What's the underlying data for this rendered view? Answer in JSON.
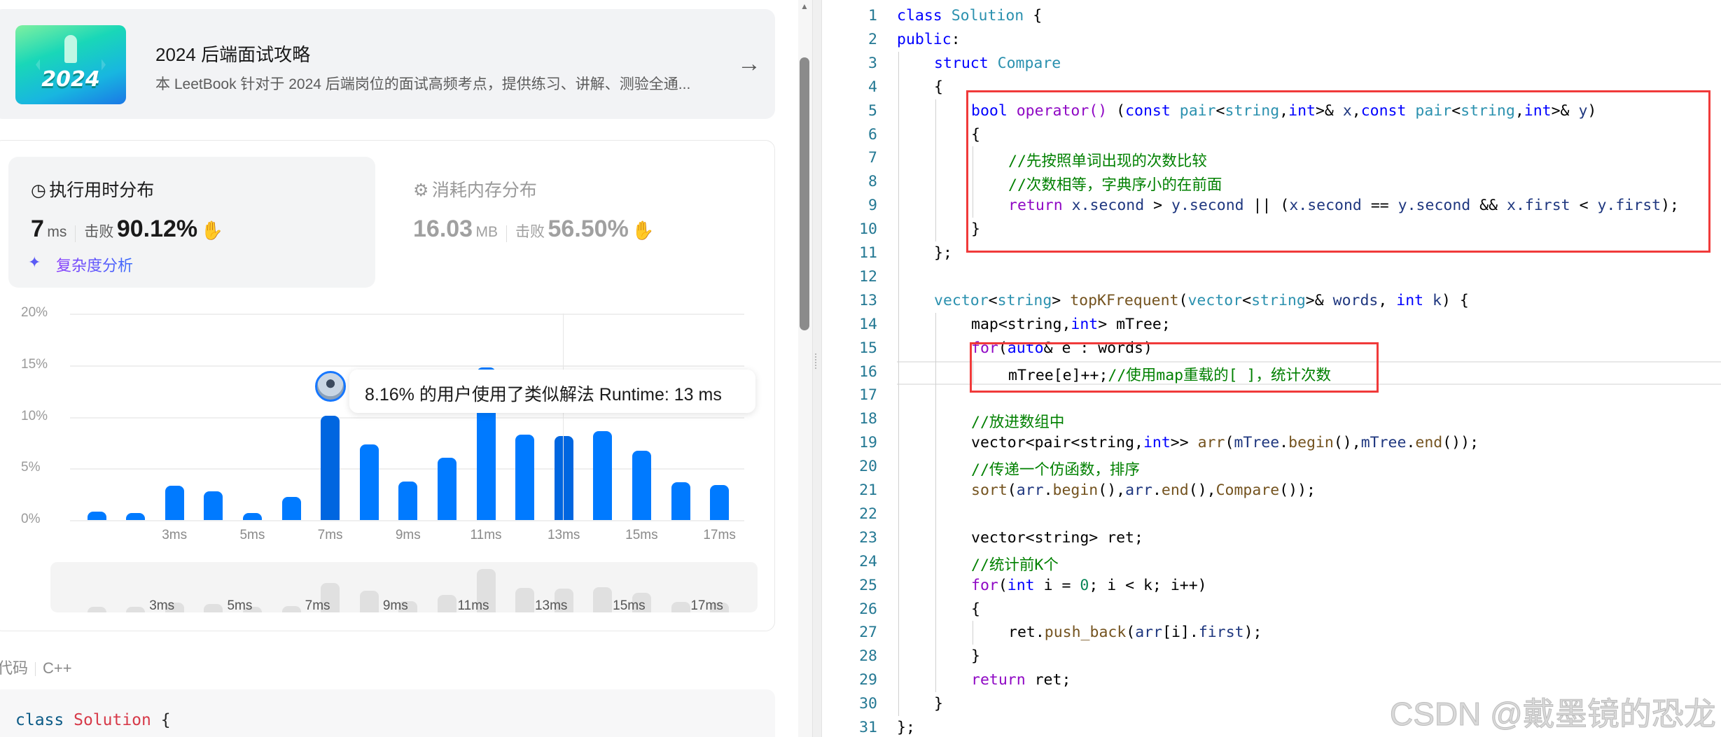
{
  "book": {
    "cover_text": "2024",
    "title": "2024 后端面试攻略",
    "description": "本 LeetBook 针对于 2024 后端岗位的面试高频考点，提供练习、讲解、测验全通...",
    "arrow_icon": "arrow-right-icon"
  },
  "runtime": {
    "title": "执行用时分布",
    "value": "7",
    "unit": "ms",
    "beat_label": "击败",
    "beat_value": "90.12%",
    "complexity_label": "复杂度分析"
  },
  "memory": {
    "title": "消耗内存分布",
    "value": "16.03",
    "unit": "MB",
    "beat_label": "击败",
    "beat_value": "56.50%"
  },
  "tooltip": {
    "text": "8.16% 的用户使用了类似解法 Runtime: 13 ms"
  },
  "colors": {
    "bar": "#007aff",
    "bar_highlight": "#0066e0",
    "mini_bar": "#e0e0e0",
    "highlight_box": "#f03a3a"
  },
  "chart_data": {
    "type": "bar",
    "x": [
      1,
      2,
      3,
      4,
      5,
      6,
      7,
      8,
      9,
      10,
      11,
      12,
      13,
      14,
      15,
      16,
      17
    ],
    "values": [
      0.8,
      0.7,
      3.35,
      2.75,
      0.7,
      2.25,
      10.1,
      7.3,
      3.75,
      6.05,
      14.8,
      8.25,
      8.16,
      8.6,
      6.7,
      3.65,
      3.4
    ],
    "highlighted": [
      7,
      13
    ],
    "ylim": [
      0,
      20
    ],
    "yticks": [
      "0%",
      "5%",
      "10%",
      "15%",
      "20%"
    ],
    "xticks": [
      "3ms",
      "5ms",
      "7ms",
      "9ms",
      "11ms",
      "13ms",
      "15ms",
      "17ms"
    ],
    "grid": true
  },
  "code_section": {
    "label": "代码",
    "language": "C++",
    "lines": [
      [
        {
          "t": "class ",
          "s": "k"
        },
        {
          "t": "Solution",
          "s": "c2"
        },
        {
          "t": " {",
          "s": "p"
        }
      ],
      [
        {
          "t": "public:",
          "s": "k"
        }
      ]
    ]
  },
  "code": {
    "lines": [
      {
        "i": 0,
        "tk": [
          {
            "t": "class",
            "s": "k"
          },
          {
            "t": " ",
            "s": "p"
          },
          {
            "t": "Solution",
            "s": "t"
          },
          {
            "t": " {",
            "s": "p"
          }
        ]
      },
      {
        "i": 0,
        "tk": [
          {
            "t": "public",
            "s": "k"
          },
          {
            "t": ":",
            "s": "p"
          }
        ]
      },
      {
        "i": 1,
        "tk": [
          {
            "t": "struct",
            "s": "k"
          },
          {
            "t": " ",
            "s": "p"
          },
          {
            "t": "Compare",
            "s": "t"
          }
        ]
      },
      {
        "i": 1,
        "tk": [
          {
            "t": "{",
            "s": "p"
          }
        ]
      },
      {
        "i": 2,
        "tk": [
          {
            "t": "bool",
            "s": "k"
          },
          {
            "t": " ",
            "s": "p"
          },
          {
            "t": "operator()",
            "s": "c"
          },
          {
            "t": " (",
            "s": "p"
          },
          {
            "t": "const",
            "s": "k"
          },
          {
            "t": " ",
            "s": "p"
          },
          {
            "t": "pair",
            "s": "t"
          },
          {
            "t": "<",
            "s": "p"
          },
          {
            "t": "string",
            "s": "t"
          },
          {
            "t": ",",
            "s": "p"
          },
          {
            "t": "int",
            "s": "k"
          },
          {
            "t": ">& ",
            "s": "p"
          },
          {
            "t": "x",
            "s": "v"
          },
          {
            "t": ",",
            "s": "p"
          },
          {
            "t": "const",
            "s": "k"
          },
          {
            "t": " ",
            "s": "p"
          },
          {
            "t": "pair",
            "s": "t"
          },
          {
            "t": "<",
            "s": "p"
          },
          {
            "t": "string",
            "s": "t"
          },
          {
            "t": ",",
            "s": "p"
          },
          {
            "t": "int",
            "s": "k"
          },
          {
            "t": ">& ",
            "s": "p"
          },
          {
            "t": "y",
            "s": "v"
          },
          {
            "t": ")",
            "s": "p"
          }
        ]
      },
      {
        "i": 2,
        "tk": [
          {
            "t": "{",
            "s": "p"
          }
        ]
      },
      {
        "i": 3,
        "tk": [
          {
            "t": "//先按照单词出现的次数比较",
            "s": "m"
          }
        ]
      },
      {
        "i": 3,
        "tk": [
          {
            "t": "//次数相等，字典序小的在前面",
            "s": "m"
          }
        ]
      },
      {
        "i": 3,
        "tk": [
          {
            "t": "return",
            "s": "c"
          },
          {
            "t": " ",
            "s": "p"
          },
          {
            "t": "x.second",
            "s": "v"
          },
          {
            "t": " > ",
            "s": "p"
          },
          {
            "t": "y.second",
            "s": "v"
          },
          {
            "t": " || (",
            "s": "p"
          },
          {
            "t": "x.second",
            "s": "v"
          },
          {
            "t": " == ",
            "s": "p"
          },
          {
            "t": "y.second",
            "s": "v"
          },
          {
            "t": " && ",
            "s": "p"
          },
          {
            "t": "x.first",
            "s": "v"
          },
          {
            "t": " < ",
            "s": "p"
          },
          {
            "t": "y.first",
            "s": "v"
          },
          {
            "t": ");",
            "s": "p"
          }
        ]
      },
      {
        "i": 2,
        "tk": [
          {
            "t": "}",
            "s": "p"
          }
        ]
      },
      {
        "i": 1,
        "tk": [
          {
            "t": "};",
            "s": "p"
          }
        ]
      },
      {
        "i": 0,
        "tk": []
      },
      {
        "i": 1,
        "tk": [
          {
            "t": "vector",
            "s": "t"
          },
          {
            "t": "<",
            "s": "p"
          },
          {
            "t": "string",
            "s": "t"
          },
          {
            "t": "> ",
            "s": "p"
          },
          {
            "t": "topKFrequent",
            "s": "f"
          },
          {
            "t": "(",
            "s": "p"
          },
          {
            "t": "vector",
            "s": "t"
          },
          {
            "t": "<",
            "s": "p"
          },
          {
            "t": "string",
            "s": "t"
          },
          {
            "t": ">& ",
            "s": "p"
          },
          {
            "t": "words",
            "s": "v"
          },
          {
            "t": ", ",
            "s": "p"
          },
          {
            "t": "int",
            "s": "k"
          },
          {
            "t": " ",
            "s": "p"
          },
          {
            "t": "k",
            "s": "v"
          },
          {
            "t": ") {",
            "s": "p"
          }
        ]
      },
      {
        "i": 2,
        "tk": [
          {
            "t": "map<string,",
            "s": "p"
          },
          {
            "t": "int",
            "s": "k"
          },
          {
            "t": "> mTree;",
            "s": "p"
          }
        ]
      },
      {
        "i": 2,
        "tk": [
          {
            "t": "for",
            "s": "c"
          },
          {
            "t": "(",
            "s": "p"
          },
          {
            "t": "auto",
            "s": "k"
          },
          {
            "t": "& e : words)",
            "s": "p"
          }
        ]
      },
      {
        "i": 3,
        "tk": [
          {
            "t": "mTree[e]++;",
            "s": "p"
          },
          {
            "t": "//使用map重载的[ ]，统计次数",
            "s": "m"
          }
        ]
      },
      {
        "i": 0,
        "tk": []
      },
      {
        "i": 2,
        "tk": [
          {
            "t": "//放进数组中",
            "s": "m"
          }
        ]
      },
      {
        "i": 2,
        "tk": [
          {
            "t": "vector<pair<string,",
            "s": "p"
          },
          {
            "t": "int",
            "s": "k"
          },
          {
            "t": ">> ",
            "s": "p"
          },
          {
            "t": "arr",
            "s": "f"
          },
          {
            "t": "(",
            "s": "p"
          },
          {
            "t": "mTree",
            "s": "v"
          },
          {
            "t": ".",
            "s": "p"
          },
          {
            "t": "begin",
            "s": "f"
          },
          {
            "t": "(),",
            "s": "p"
          },
          {
            "t": "mTree",
            "s": "v"
          },
          {
            "t": ".",
            "s": "p"
          },
          {
            "t": "end",
            "s": "f"
          },
          {
            "t": "());",
            "s": "p"
          }
        ]
      },
      {
        "i": 2,
        "tk": [
          {
            "t": "//传递一个仿函数，排序",
            "s": "m"
          }
        ]
      },
      {
        "i": 2,
        "tk": [
          {
            "t": "sort",
            "s": "f"
          },
          {
            "t": "(",
            "s": "p"
          },
          {
            "t": "arr",
            "s": "v"
          },
          {
            "t": ".",
            "s": "p"
          },
          {
            "t": "begin",
            "s": "f"
          },
          {
            "t": "(),",
            "s": "p"
          },
          {
            "t": "arr",
            "s": "v"
          },
          {
            "t": ".",
            "s": "p"
          },
          {
            "t": "end",
            "s": "f"
          },
          {
            "t": "(),",
            "s": "p"
          },
          {
            "t": "Compare",
            "s": "f"
          },
          {
            "t": "());",
            "s": "p"
          }
        ]
      },
      {
        "i": 0,
        "tk": []
      },
      {
        "i": 2,
        "tk": [
          {
            "t": "vector<string> ret;",
            "s": "p"
          }
        ]
      },
      {
        "i": 2,
        "tk": [
          {
            "t": "//统计前K个",
            "s": "m"
          }
        ]
      },
      {
        "i": 2,
        "tk": [
          {
            "t": "for",
            "s": "c"
          },
          {
            "t": "(",
            "s": "p"
          },
          {
            "t": "int",
            "s": "k"
          },
          {
            "t": " i = ",
            "s": "p"
          },
          {
            "t": "0",
            "s": "n"
          },
          {
            "t": "; i < k; i++)",
            "s": "p"
          }
        ]
      },
      {
        "i": 2,
        "tk": [
          {
            "t": "{",
            "s": "p"
          }
        ]
      },
      {
        "i": 3,
        "tk": [
          {
            "t": "ret.",
            "s": "p"
          },
          {
            "t": "push_back",
            "s": "f"
          },
          {
            "t": "(",
            "s": "p"
          },
          {
            "t": "arr",
            "s": "v"
          },
          {
            "t": "[i].",
            "s": "p"
          },
          {
            "t": "first",
            "s": "v"
          },
          {
            "t": ");",
            "s": "p"
          }
        ]
      },
      {
        "i": 2,
        "tk": [
          {
            "t": "}",
            "s": "p"
          }
        ]
      },
      {
        "i": 2,
        "tk": [
          {
            "t": "return",
            "s": "c"
          },
          {
            "t": " ret;",
            "s": "p"
          }
        ]
      },
      {
        "i": 1,
        "tk": [
          {
            "t": "}",
            "s": "p"
          }
        ]
      },
      {
        "i": 0,
        "tk": [
          {
            "t": "};",
            "s": "p"
          }
        ]
      }
    ]
  },
  "watermark": "CSDN @戴墨镜的恐龙"
}
